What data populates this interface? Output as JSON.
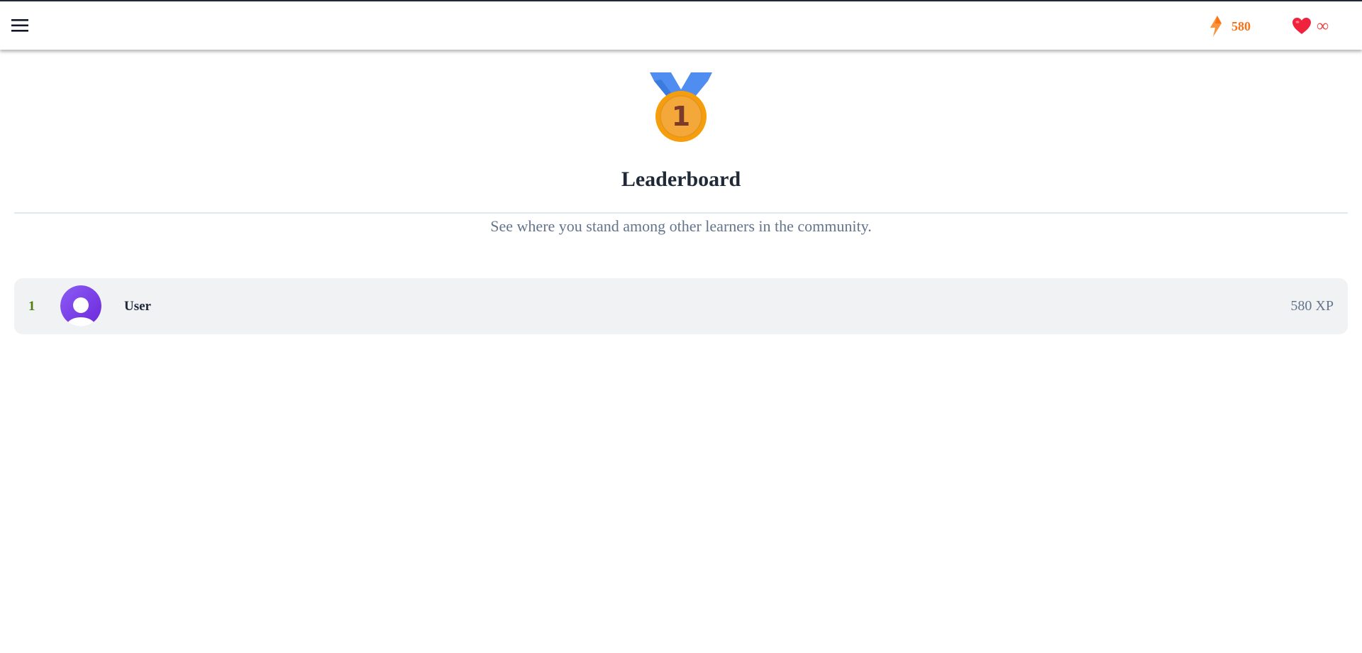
{
  "header": {
    "menu_icon": "hamburger-menu-icon",
    "xp": {
      "icon": "lightning-bolt-icon",
      "value": "580",
      "color": "#f97316"
    },
    "hearts": {
      "icon": "heart-icon",
      "value": "∞",
      "color": "#ef4444"
    }
  },
  "hero": {
    "medal_icon": "first-place-medal-icon",
    "medal_number": "1",
    "title": "Leaderboard",
    "subtitle": "See where you stand among other learners in the community."
  },
  "leaderboard": {
    "entries": [
      {
        "rank": "1",
        "avatar_icon": "user-avatar-icon",
        "name": "User",
        "xp": "580 XP"
      }
    ]
  },
  "colors": {
    "accent_orange": "#f97316",
    "heart_red": "#ef4444",
    "rank_green": "#4d7c0f",
    "avatar_purple": "#7c3aed",
    "row_bg": "#f1f2f4",
    "divider": "#e2e8f0"
  }
}
